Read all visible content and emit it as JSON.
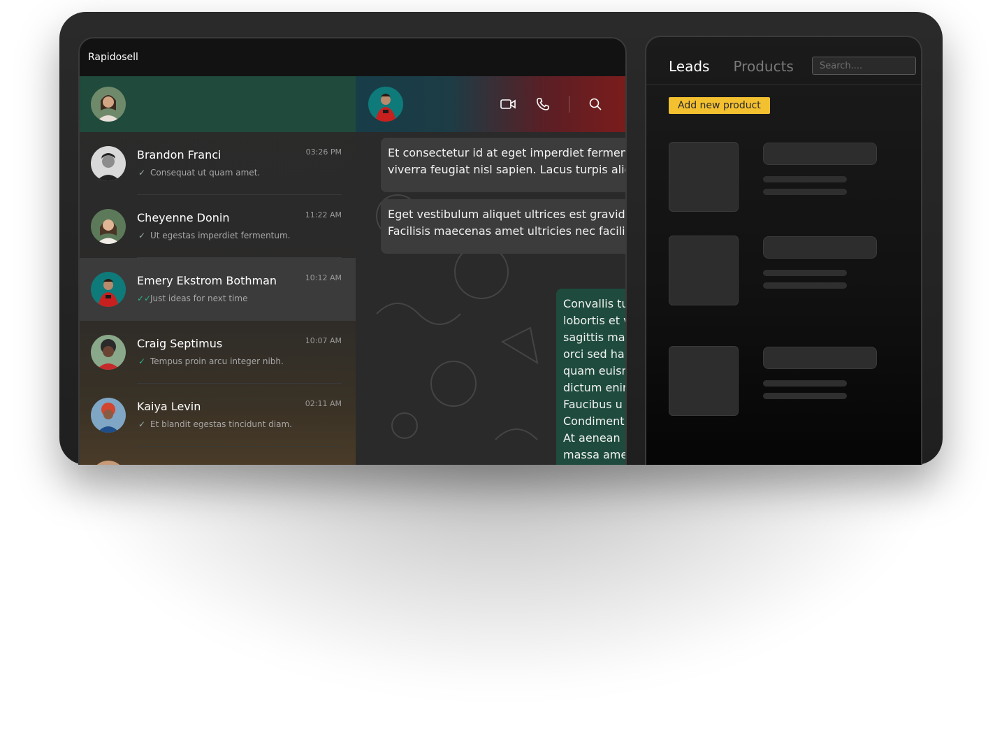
{
  "app": {
    "title": "Rapidosell"
  },
  "chats": [
    {
      "name": "Brandon Franci",
      "time": "03:26 PM",
      "preview": "Consequat ut quam amet.",
      "status": "read-check"
    },
    {
      "name": "Cheyenne Donin",
      "time": "11:22 AM",
      "preview": "Ut egestas imperdiet fermentum.",
      "status": "read-check"
    },
    {
      "name": "Emery Ekstrom Bothman",
      "time": "10:12 AM",
      "preview": "Just ideas for next time",
      "status": "double-check"
    },
    {
      "name": "Craig Septimus",
      "time": "10:07 AM",
      "preview": "Tempus proin arcu integer nibh.",
      "status": "read-check"
    },
    {
      "name": "Kaiya Levin",
      "time": "02:11 AM",
      "preview": "Et blandit egestas tincidunt diam.",
      "status": "read-check"
    }
  ],
  "conversation": {
    "messages": [
      {
        "lines": [
          "Et consectetur id at eget imperdiet fermen",
          "viverra feugiat nisl sapien. Lacus turpis aliq"
        ]
      },
      {
        "lines": [
          "Eget vestibulum aliquet ultrices est gravida",
          "Facilisis maecenas amet ultricies nec facili"
        ]
      },
      {
        "lines": [
          "Convallis tu",
          "lobortis et v",
          "sagittis ma",
          "orci sed ha",
          "quam euisn",
          "dictum enim",
          "Faucibus u",
          "Condiment",
          "At aenean",
          "massa ame"
        ]
      }
    ]
  },
  "right_panel": {
    "tabs": [
      "Leads",
      "Products"
    ],
    "search_placeholder": "Search....",
    "add_button": "Add new product"
  },
  "icons": [
    "video-camera-icon",
    "phone-icon",
    "search-icon",
    "check-icon",
    "double-check-icon"
  ],
  "colors": {
    "accent_green": "#1f4a3c",
    "accent_yellow": "#f3c030",
    "read_check": "#2fb089"
  }
}
